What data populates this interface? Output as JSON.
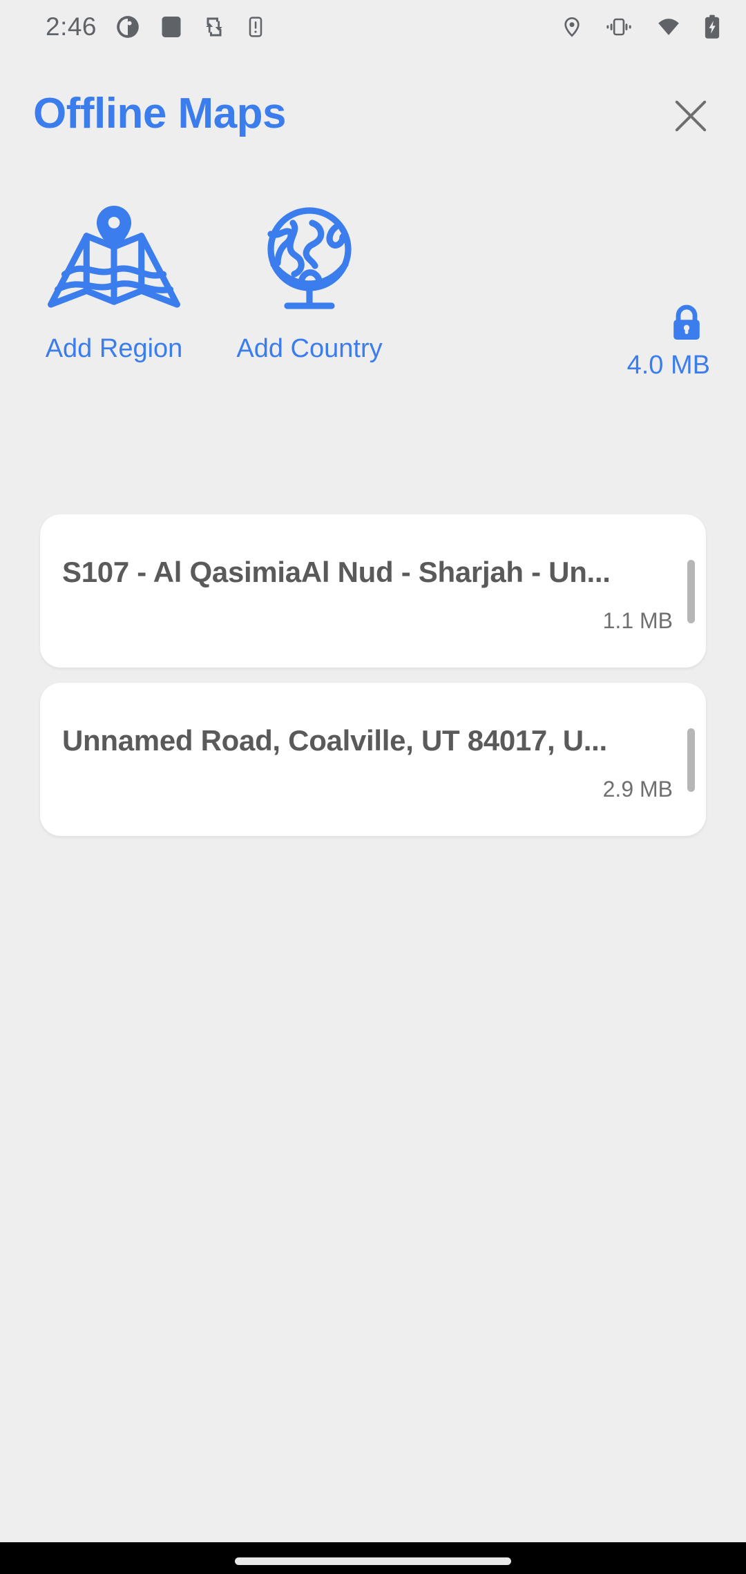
{
  "theme": {
    "background": "#eeeeee",
    "accent": "#3b7ded",
    "card_background": "#ffffff",
    "title_text": "#5a5a5a",
    "muted_text": "#6f6f6f",
    "status_icon": "#5f6368",
    "nav_bar": "#000000"
  },
  "status_bar": {
    "time": "2:46",
    "left_icons": [
      {
        "name": "do-not-disturb-icon"
      },
      {
        "name": "filled-square-icon"
      },
      {
        "name": "data-transfer-icon"
      },
      {
        "name": "phone-alert-icon"
      }
    ],
    "right_icons": [
      {
        "name": "location-pin-icon"
      },
      {
        "name": "vibrate-icon"
      },
      {
        "name": "wifi-icon"
      },
      {
        "name": "battery-charging-icon"
      }
    ]
  },
  "header": {
    "title": "Offline Maps",
    "close_label": "Close"
  },
  "actions": [
    {
      "id": "add-region",
      "label": "Add Region",
      "icon": "folded-map-pin-icon"
    },
    {
      "id": "add-country",
      "label": "Add Country",
      "icon": "globe-stand-icon"
    }
  ],
  "storage": {
    "icon": "lock-icon",
    "size": "4.0 MB"
  },
  "map_list": [
    {
      "title": "S107 - Al QasimiaAl Nud - Sharjah - Un...",
      "size": "1.1 MB"
    },
    {
      "title": "Unnamed Road, Coalville, UT 84017, U...",
      "size": "2.9 MB"
    }
  ],
  "nav_bar": {
    "gesture_pill": "home-gesture-pill"
  }
}
